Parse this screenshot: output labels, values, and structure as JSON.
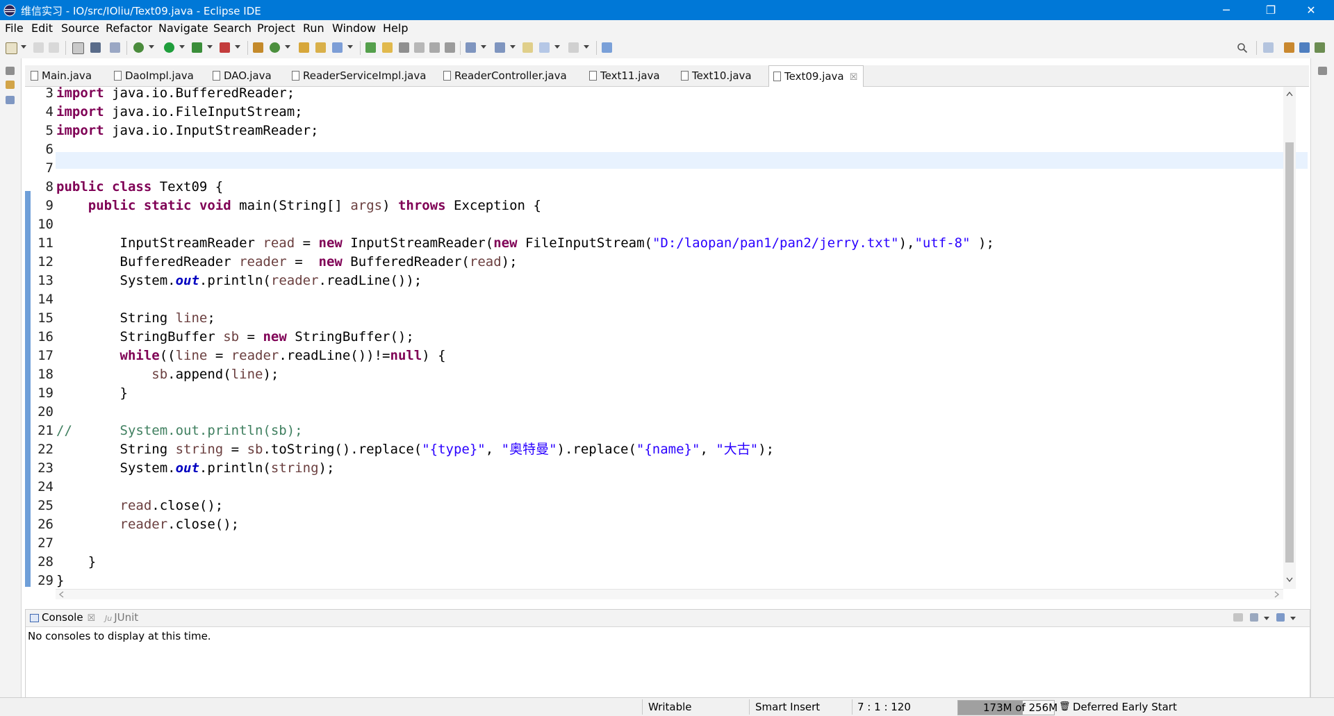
{
  "window": {
    "title": "维信实习 - IO/src/IOliu/Text09.java - Eclipse IDE",
    "controls": {
      "minimize": "─",
      "restore": "❐",
      "close": "✕"
    }
  },
  "menu": [
    "File",
    "Edit",
    "Source",
    "Refactor",
    "Navigate",
    "Search",
    "Project",
    "Run",
    "Window",
    "Help"
  ],
  "tabs": [
    {
      "label": "Main.java",
      "active": false
    },
    {
      "label": "DaoImpl.java",
      "active": false
    },
    {
      "label": "DAO.java",
      "active": false
    },
    {
      "label": "ReaderServiceImpl.java",
      "active": false
    },
    {
      "label": "ReaderController.java",
      "active": false
    },
    {
      "label": "Text11.java",
      "active": false
    },
    {
      "label": "Text10.java",
      "active": false
    },
    {
      "label": "Text09.java",
      "active": true
    }
  ],
  "tab_close_glyph": "☒",
  "editor": {
    "lines": [
      {
        "n": "3",
        "html": "<span class='kw'>import</span> java.io.BufferedReader;"
      },
      {
        "n": "4",
        "html": "<span class='kw'>import</span> java.io.FileInputStream;"
      },
      {
        "n": "5",
        "html": "<span class='kw'>import</span> java.io.InputStreamReader;"
      },
      {
        "n": "6",
        "html": ""
      },
      {
        "n": "7",
        "html": ""
      },
      {
        "n": "8",
        "html": "<span class='kw'>public</span> <span class='kw'>class</span> Text09 {"
      },
      {
        "n": "9",
        "html": "    <span class='kw'>public</span> <span class='kw'>static</span> <span class='kw'>void</span> main(String[] <span class='lv'>args</span>) <span class='kw'>throws</span> Exception {"
      },
      {
        "n": "10",
        "html": ""
      },
      {
        "n": "11",
        "html": "        InputStreamReader <span class='lv'>read</span> = <span class='kw'>new</span> InputStreamReader(<span class='kw'>new</span> FileInputStream(<span class='str'>\"D:/laopan/pan1/pan2/jerry.txt\"</span>),<span class='str'>\"utf-8\"</span> );"
      },
      {
        "n": "12",
        "html": "        BufferedReader <span class='lv'>reader</span> =  <span class='kw'>new</span> BufferedReader(<span class='lv'>read</span>);"
      },
      {
        "n": "13",
        "html": "        System.<span class='fld'>out</span>.println(<span class='lv'>reader</span>.readLine());"
      },
      {
        "n": "14",
        "html": ""
      },
      {
        "n": "15",
        "html": "        String <span class='lv'>line</span>;"
      },
      {
        "n": "16",
        "html": "        StringBuffer <span class='lv'>sb</span> = <span class='kw'>new</span> StringBuffer();"
      },
      {
        "n": "17",
        "html": "        <span class='kw'>while</span>((<span class='lv'>line</span> = <span class='lv'>reader</span>.readLine())!=<span class='kw'>null</span>) {"
      },
      {
        "n": "18",
        "html": "            <span class='lv'>sb</span>.append(<span class='lv'>line</span>);"
      },
      {
        "n": "19",
        "html": "        }"
      },
      {
        "n": "20",
        "html": ""
      },
      {
        "n": "21",
        "html": "<span class='cmt'>//      System.out.println(sb);</span>"
      },
      {
        "n": "22",
        "html": "        String <span class='lv'>string</span> = <span class='lv'>sb</span>.toString().replace(<span class='str'>\"{type}\"</span>, <span class='str'>\"奥特曼\"</span>).replace(<span class='str'>\"{name}\"</span>, <span class='str'>\"大古\"</span>);"
      },
      {
        "n": "23",
        "html": "        System.<span class='fld'>out</span>.println(<span class='lv'>string</span>);"
      },
      {
        "n": "24",
        "html": ""
      },
      {
        "n": "25",
        "html": "        <span class='lv'>read</span>.close();"
      },
      {
        "n": "26",
        "html": "        <span class='lv'>reader</span>.close();"
      },
      {
        "n": "27",
        "html": ""
      },
      {
        "n": "28",
        "html": "    }"
      },
      {
        "n": "29",
        "html": "}"
      }
    ]
  },
  "console": {
    "tabs": [
      {
        "label": "Console"
      },
      {
        "label": "JUnit"
      }
    ],
    "message": "No consoles to display at this time."
  },
  "status": {
    "writable": "Writable",
    "insert_mode": "Smart Insert",
    "position": "7 : 1 : 120",
    "heap": "173M of 256M",
    "heap_fraction": 0.676,
    "job": "Deferred Early Start"
  },
  "colors": {
    "titlebar": "#0078d7",
    "keyword": "#7f0055",
    "string": "#2a00ff",
    "comment": "#3f7f5f",
    "static_field": "#0000c0",
    "local_var": "#6a3e3e",
    "current_line": "#e8f2fe"
  }
}
